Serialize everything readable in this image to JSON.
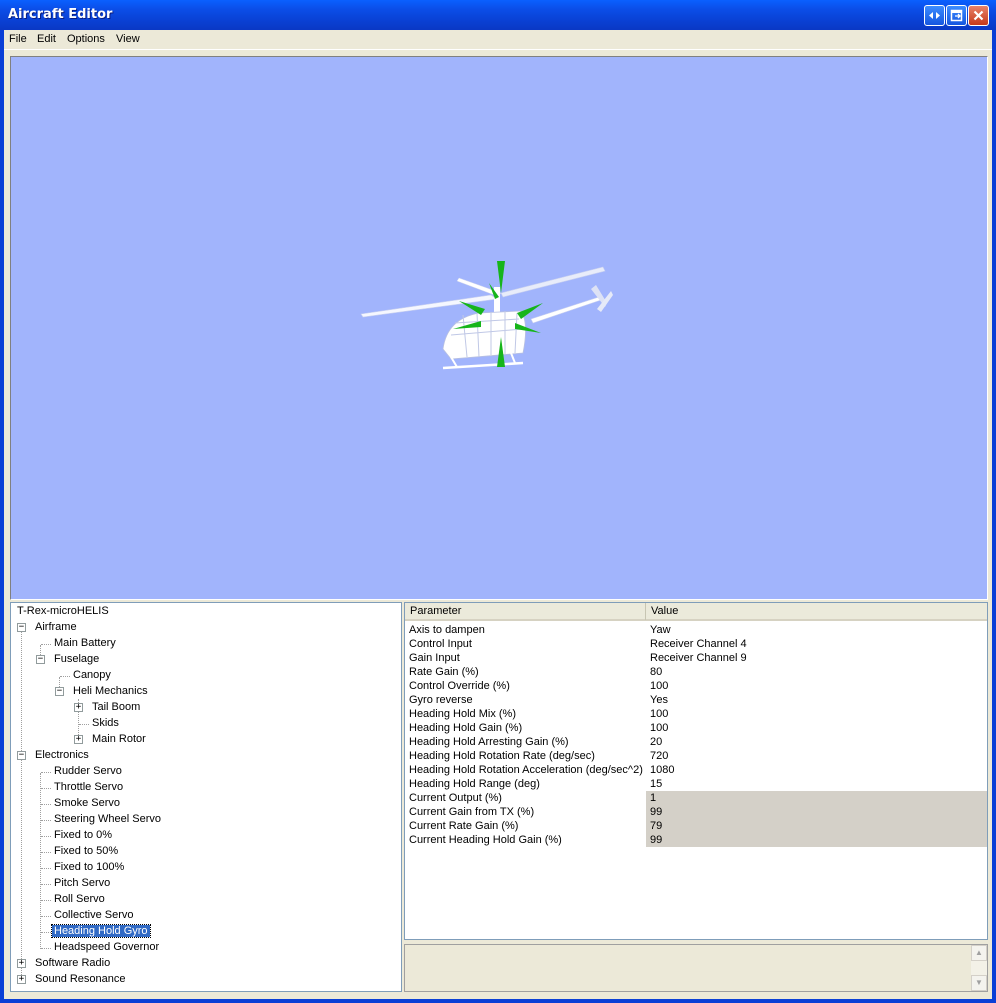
{
  "window": {
    "title": "Aircraft Editor"
  },
  "menu": {
    "file": "File",
    "edit": "Edit",
    "options": "Options",
    "view": "View"
  },
  "viewport": {
    "background": "#a1b4fc",
    "model_color": "#ffffff",
    "gizmo_color": "#16b51a"
  },
  "tree": {
    "root": "T-Rex-microHELIS",
    "items": {
      "airframe": "Airframe",
      "main_battery": "Main Battery",
      "fuselage": "Fuselage",
      "canopy": "Canopy",
      "heli_mechanics": "Heli Mechanics",
      "tail_boom": "Tail Boom",
      "skids": "Skids",
      "main_rotor": "Main Rotor",
      "electronics": "Electronics",
      "rudder_servo": "Rudder Servo",
      "throttle_servo": "Throttle Servo",
      "smoke_servo": "Smoke Servo",
      "steering_wheel_servo": "Steering Wheel Servo",
      "fixed_0": "Fixed to 0%",
      "fixed_50": "Fixed to 50%",
      "fixed_100": "Fixed to 100%",
      "pitch_servo": "Pitch Servo",
      "roll_servo": "Roll Servo",
      "collective_servo": "Collective Servo",
      "heading_hold_gyro": "Heading Hold Gyro",
      "headspeed_governor": "Headspeed Governor",
      "software_radio": "Software Radio",
      "sound_resonance": "Sound Resonance"
    },
    "selected": "Heading Hold Gyro"
  },
  "grid": {
    "headers": {
      "parameter": "Parameter",
      "value": "Value"
    },
    "rows": [
      {
        "param": "Axis to dampen",
        "value": "Yaw"
      },
      {
        "param": "Control Input",
        "value": "Receiver Channel 4"
      },
      {
        "param": "Gain Input",
        "value": "Receiver Channel 9"
      },
      {
        "param": "Rate Gain (%)",
        "value": "80"
      },
      {
        "param": "Control Override (%)",
        "value": "100"
      },
      {
        "param": "Gyro reverse",
        "value": "Yes"
      },
      {
        "param": "Heading Hold Mix (%)",
        "value": "100"
      },
      {
        "param": "Heading Hold Gain (%)",
        "value": "100"
      },
      {
        "param": "Heading Hold Arresting Gain (%)",
        "value": "20"
      },
      {
        "param": "Heading Hold Rotation Rate (deg/sec)",
        "value": "720"
      },
      {
        "param": "Heading Hold Rotation Acceleration (deg/sec^2)",
        "value": "1080"
      },
      {
        "param": "Heading Hold Range (deg)",
        "value": "15"
      },
      {
        "param": "Current Output (%)",
        "value": "1"
      },
      {
        "param": "Current Gain from TX (%)",
        "value": "99"
      },
      {
        "param": "Current Rate Gain (%)",
        "value": "79"
      },
      {
        "param": "Current Heading Hold Gain (%)",
        "value": "99"
      }
    ]
  }
}
